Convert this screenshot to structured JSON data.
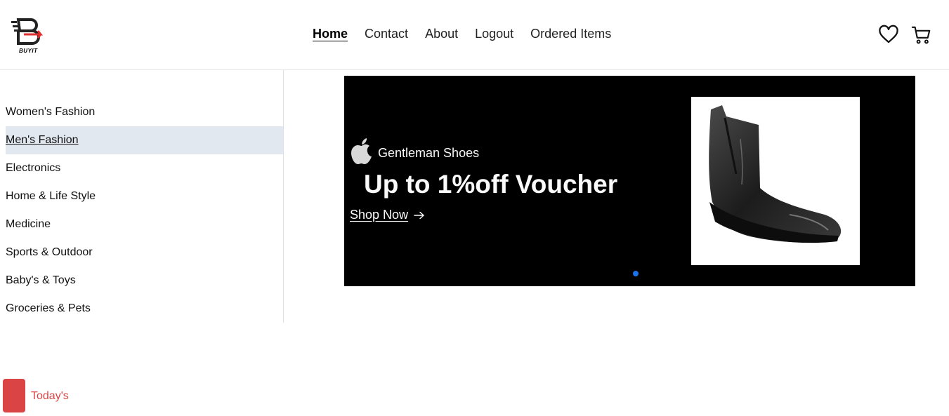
{
  "brand": {
    "logo_text": "BUYIT"
  },
  "nav": {
    "items": [
      {
        "label": "Home",
        "active": true
      },
      {
        "label": "Contact"
      },
      {
        "label": "About"
      },
      {
        "label": "Logout"
      },
      {
        "label": "Ordered Items"
      }
    ]
  },
  "header_icons": [
    "heart-icon",
    "cart-icon"
  ],
  "sidebar": {
    "items": [
      {
        "label": "Women's Fashion"
      },
      {
        "label": "Men's Fashion",
        "active": true
      },
      {
        "label": "Electronics"
      },
      {
        "label": "Home & Life Style"
      },
      {
        "label": "Medicine"
      },
      {
        "label": "Sports & Outdoor"
      },
      {
        "label": "Baby's & Toys"
      },
      {
        "label": "Groceries & Pets"
      }
    ]
  },
  "banner": {
    "brand_icon": "apple-icon",
    "brand_label": "Gentleman Shoes",
    "headline": "Up to 1%off Voucher",
    "cta_label": "Shop Now",
    "cta_icon": "arrow-right-icon",
    "product_image": "black-chelsea-boot",
    "slide_count": 1,
    "active_slide": 1,
    "dot_color": "#1a73e8"
  },
  "section": {
    "label": "Today's",
    "accent_color": "#db4444"
  }
}
